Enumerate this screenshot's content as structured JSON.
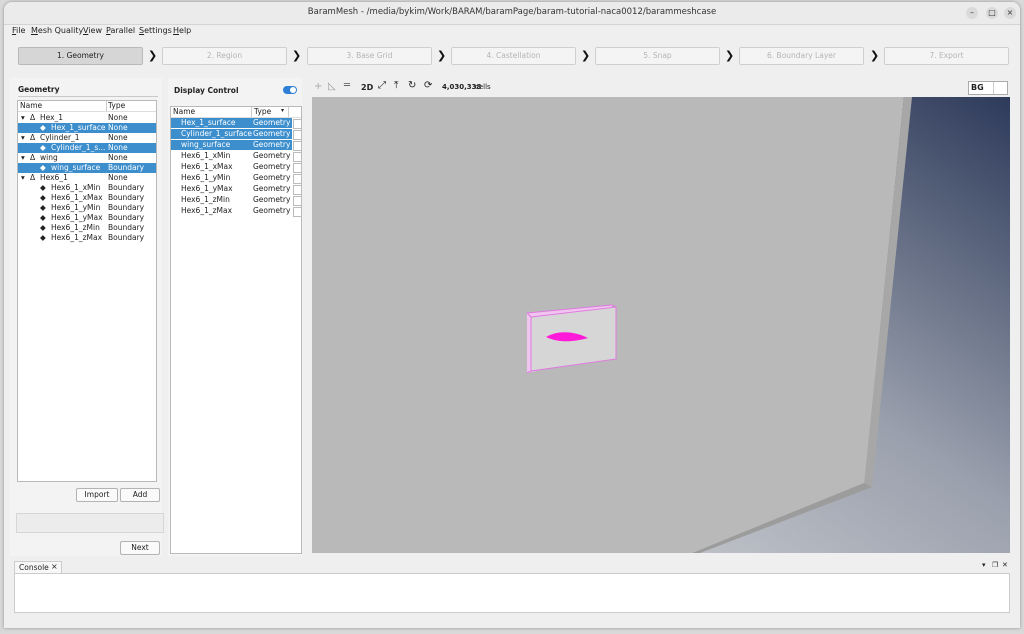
{
  "window": {
    "title": "BaramMesh - /media/bykim/Work/BARAM/baramPage/baram-tutorial-naca0012/barammeshcase"
  },
  "menu": [
    "File",
    "Mesh Quality",
    "View",
    "Parallel",
    "Settings",
    "Help"
  ],
  "steps": [
    "1. Geometry",
    "2. Region",
    "3. Base Grid",
    "4. Castellation",
    "5. Snap",
    "6. Boundary Layer",
    "7. Export"
  ],
  "geometry": {
    "title": "Geometry",
    "col_name": "Name",
    "col_type": "Type",
    "rows": [
      {
        "name": "Hex_1",
        "type": "None"
      },
      {
        "name": "Hex_1_surface",
        "type": "None"
      },
      {
        "name": "Cylinder_1",
        "type": "None"
      },
      {
        "name": "Cylinder_1_s...",
        "type": "None"
      },
      {
        "name": "wing",
        "type": "None"
      },
      {
        "name": "wing_surface",
        "type": "Boundary"
      },
      {
        "name": "Hex6_1",
        "type": "None"
      },
      {
        "name": "Hex6_1_xMin",
        "type": "Boundary"
      },
      {
        "name": "Hex6_1_xMax",
        "type": "Boundary"
      },
      {
        "name": "Hex6_1_yMin",
        "type": "Boundary"
      },
      {
        "name": "Hex6_1_yMax",
        "type": "Boundary"
      },
      {
        "name": "Hex6_1_zMin",
        "type": "Boundary"
      },
      {
        "name": "Hex6_1_zMax",
        "type": "Boundary"
      }
    ],
    "import_label": "Import",
    "add_label": "Add",
    "next_label": "Next"
  },
  "display": {
    "title": "Display Control",
    "col_name": "Name",
    "col_type": "Type",
    "rows": [
      {
        "name": "Hex_1_surface",
        "type": "Geometry"
      },
      {
        "name": "Cylinder_1_surface",
        "type": "Geometry"
      },
      {
        "name": "wing_surface",
        "type": "Geometry"
      },
      {
        "name": "Hex6_1_xMin",
        "type": "Geometry"
      },
      {
        "name": "Hex6_1_xMax",
        "type": "Geometry"
      },
      {
        "name": "Hex6_1_yMin",
        "type": "Geometry"
      },
      {
        "name": "Hex6_1_yMax",
        "type": "Geometry"
      },
      {
        "name": "Hex6_1_zMin",
        "type": "Geometry"
      },
      {
        "name": "Hex6_1_zMax",
        "type": "Geometry"
      }
    ]
  },
  "toolbar": {
    "mode_2d": "2D",
    "cells": "4,030,338",
    "cells_suffix": "cells",
    "bg": "BG"
  },
  "console": {
    "tab": "Console",
    "close": "×"
  },
  "colors": {
    "selection": "#3c8ecd",
    "accent_toggle": "#2f7fd6",
    "wing": "#ff1ad9"
  }
}
